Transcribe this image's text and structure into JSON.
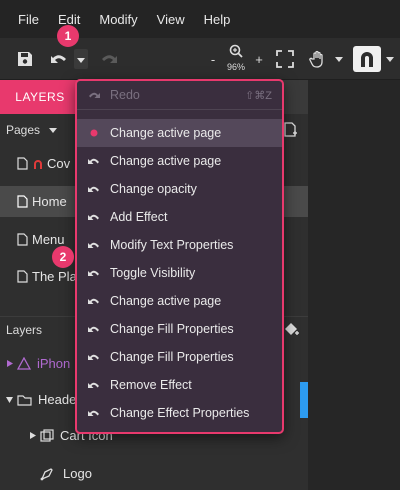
{
  "menu": [
    "File",
    "Edit",
    "Modify",
    "View",
    "Help"
  ],
  "toolbar": {
    "zoom": "96%",
    "zoom_minus": "-",
    "zoom_plus": "+"
  },
  "left": {
    "tab_layers": "LAYERS",
    "pages_header": "Pages",
    "pages": [
      "Cov",
      "Home",
      "Menu",
      "The Pla"
    ],
    "layers_header": "Layers",
    "layers": [
      "iPhon",
      "Heade",
      "Cart Icon",
      "Logo"
    ]
  },
  "history": {
    "redo_label": "Redo",
    "redo_shortcut": "⇧⌘Z",
    "items": [
      "Change active page",
      "Change active page",
      "Change opacity",
      "Add Effect",
      "Modify Text Properties",
      "Toggle Visibility",
      "Change active page",
      "Change Fill Properties",
      "Change Fill Properties",
      "Remove Effect",
      "Change Effect Properties"
    ]
  },
  "badges": [
    "1",
    "2"
  ],
  "colors": {
    "accent": "#e8396d",
    "dropdown_bg": "#3a2e3e",
    "active_row": "#54485a",
    "selection_blue": "#2d9bf0"
  }
}
